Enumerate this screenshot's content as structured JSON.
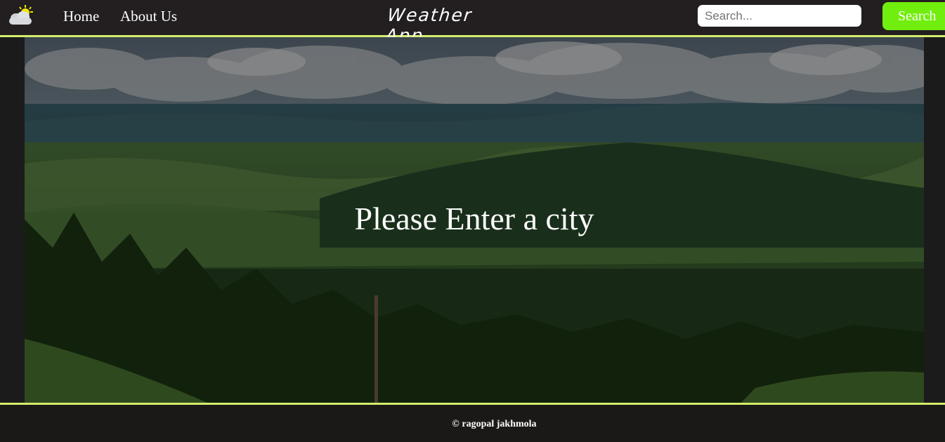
{
  "nav": {
    "logo_icon": "sun-cloud-icon",
    "home_label": "Home",
    "about_label": "About Us",
    "brand": "Weather App",
    "search_placeholder": "Search...",
    "search_button_label": "Search"
  },
  "hero": {
    "background_image": "mountain-forest-landscape",
    "message": "Please Enter a city"
  },
  "footer": {
    "text": "© ragopal jakhmola"
  },
  "colors": {
    "nav_bg": "#231f20",
    "accent_line": "#d4ed6b",
    "search_button": "#71ee0d",
    "page_bg": "#1c1b1b"
  }
}
